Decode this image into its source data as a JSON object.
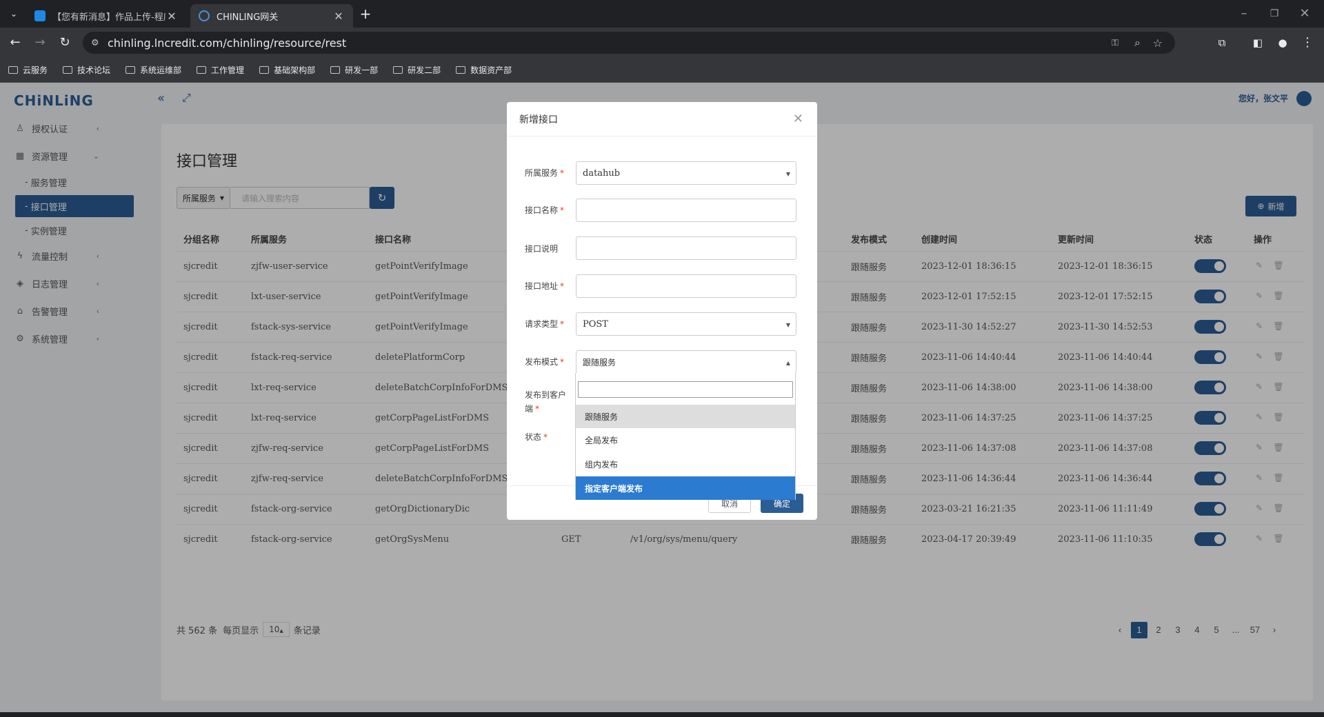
{
  "browser": {
    "tabs": [
      {
        "title": "【您有新消息】作品上传-程序..."
      },
      {
        "title": "CHINLING网关"
      }
    ],
    "url": "chinling.lncredit.com/chinling/resource/rest",
    "bookmarks": [
      "云服务",
      "技术论坛",
      "系统运维部",
      "工作管理",
      "基础架构部",
      "研发一部",
      "研发二部",
      "数据资产部"
    ]
  },
  "app": {
    "logo": "CHiNLiNG",
    "greeting": "您好，张文平",
    "sidebar": {
      "items": [
        {
          "label": "授权认证",
          "icon": "user-icon"
        },
        {
          "label": "资源管理",
          "icon": "grid-icon"
        },
        {
          "label": "流量控制",
          "icon": "bolt-icon"
        },
        {
          "label": "日志管理",
          "icon": "layers-icon"
        },
        {
          "label": "告警管理",
          "icon": "bank-icon"
        },
        {
          "label": "系统管理",
          "icon": "gear-icon"
        }
      ],
      "subitems": [
        "服务管理",
        "接口管理",
        "实例管理"
      ]
    },
    "page_title": "接口管理",
    "filter": {
      "select_label": "所属服务",
      "search_placeholder": "请输入搜索内容"
    },
    "add_button": "新增",
    "table": {
      "headers": [
        "分组名称",
        "所属服务",
        "接口名称",
        "发布模式",
        "创建时间",
        "更新时间",
        "状态",
        "操作"
      ],
      "rows": [
        {
          "group": "sjcredit",
          "service": "zjfw-user-service",
          "name": "getPointVerifyImage",
          "method": "",
          "path": "",
          "mode": "跟随服务",
          "created": "2023-12-01 18:36:15",
          "updated": "2023-12-01 18:36:15"
        },
        {
          "group": "sjcredit",
          "service": "lxt-user-service",
          "name": "getPointVerifyImage",
          "method": "",
          "path": "",
          "mode": "跟随服务",
          "created": "2023-12-01 17:52:15",
          "updated": "2023-12-01 17:52:15"
        },
        {
          "group": "sjcredit",
          "service": "fstack-sys-service",
          "name": "getPointVerifyImage",
          "method": "",
          "path": "",
          "mode": "跟随服务",
          "created": "2023-11-30 14:52:27",
          "updated": "2023-11-30 14:52:53"
        },
        {
          "group": "sjcredit",
          "service": "fstack-req-service",
          "name": "deletePlatformCorp",
          "method": "",
          "path": "",
          "mode": "跟随服务",
          "created": "2023-11-06 14:40:44",
          "updated": "2023-11-06 14:40:44"
        },
        {
          "group": "sjcredit",
          "service": "lxt-req-service",
          "name": "deleteBatchCorpInfoForDMS",
          "method": "",
          "path": "",
          "mode": "跟随服务",
          "created": "2023-11-06 14:38:00",
          "updated": "2023-11-06 14:38:00"
        },
        {
          "group": "sjcredit",
          "service": "lxt-req-service",
          "name": "getCorpPageListForDMS",
          "method": "",
          "path": "",
          "mode": "跟随服务",
          "created": "2023-11-06 14:37:25",
          "updated": "2023-11-06 14:37:25"
        },
        {
          "group": "sjcredit",
          "service": "zjfw-req-service",
          "name": "getCorpPageListForDMS",
          "method": "",
          "path": "",
          "mode": "跟随服务",
          "created": "2023-11-06 14:37:08",
          "updated": "2023-11-06 14:37:08"
        },
        {
          "group": "sjcredit",
          "service": "zjfw-req-service",
          "name": "deleteBatchCorpInfoForDMS",
          "method": "",
          "path": "",
          "mode": "跟随服务",
          "created": "2023-11-06 14:36:44",
          "updated": "2023-11-06 14:36:44"
        },
        {
          "group": "sjcredit",
          "service": "fstack-org-service",
          "name": "getOrgDictionaryDic",
          "method": "",
          "path": "",
          "mode": "跟随服务",
          "created": "2023-03-21 16:21:35",
          "updated": "2023-11-06 11:11:49"
        },
        {
          "group": "sjcredit",
          "service": "fstack-org-service",
          "name": "getOrgSysMenu",
          "method": "GET",
          "path": "/v1/org/sys/menu/query",
          "mode": "跟随服务",
          "created": "2023-04-17 20:39:49",
          "updated": "2023-11-06 11:10:35"
        }
      ]
    },
    "pagination": {
      "total_prefix": "共 562 条",
      "per_page_label": "每页显示",
      "per_page": "10",
      "suffix": "条记录",
      "pages": [
        "1",
        "2",
        "3",
        "4",
        "5",
        "...",
        "57"
      ],
      "current": "1"
    }
  },
  "modal": {
    "title": "新增接口",
    "fields": {
      "service": {
        "label": "所属服务",
        "value": "datahub"
      },
      "name": {
        "label": "接口名称",
        "value": ""
      },
      "desc": {
        "label": "接口说明",
        "value": ""
      },
      "path": {
        "label": "接口地址",
        "value": ""
      },
      "method": {
        "label": "请求类型",
        "value": "POST"
      },
      "mode": {
        "label": "发布模式",
        "value": "跟随服务"
      },
      "clients": {
        "label": "发布到客户端"
      },
      "status": {
        "label": "状态"
      }
    },
    "dropdown_options": [
      "跟随服务",
      "全局发布",
      "组内发布",
      "指定客户端发布"
    ],
    "cancel_label": "取消",
    "ok_label": "确定"
  },
  "colors": {
    "primary": "#2b5d95",
    "highlight": "#2b7bd0"
  }
}
